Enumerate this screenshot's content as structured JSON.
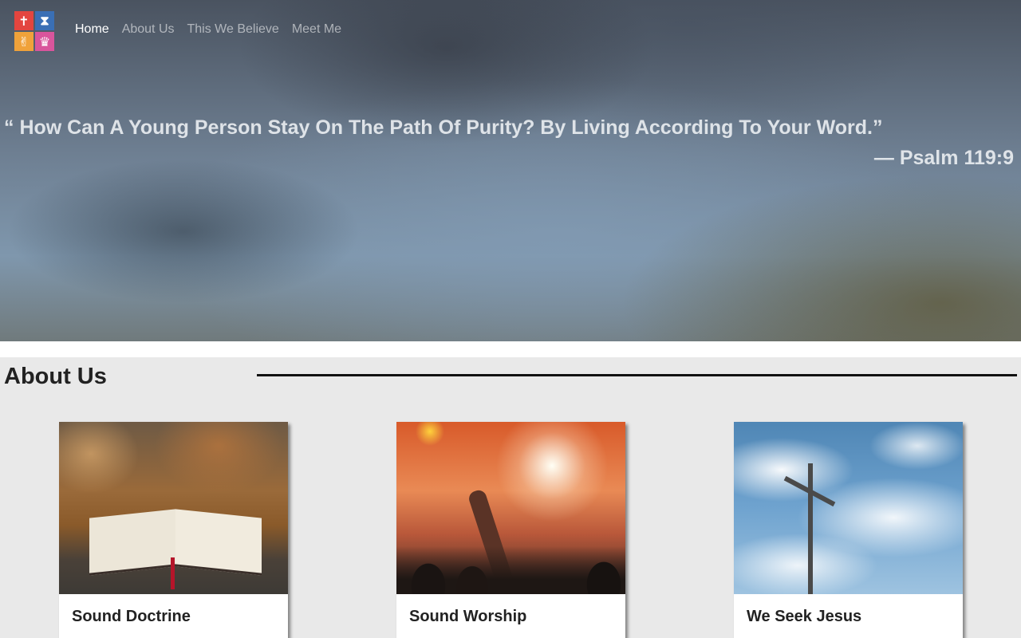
{
  "nav": {
    "logo_alt": "Site logo",
    "links": [
      {
        "label": "Home",
        "active": true
      },
      {
        "label": "About Us",
        "active": false
      },
      {
        "label": "This We Believe",
        "active": false
      },
      {
        "label": "Meet Me",
        "active": false
      }
    ]
  },
  "hero": {
    "quote": "“ How Can A Young Person Stay On The Path Of Purity? By Living According To Your Word.”",
    "citation": "— Psalm 119:9"
  },
  "about": {
    "title": "About Us",
    "cards": [
      {
        "title": "Sound Doctrine",
        "image": "open bible photo"
      },
      {
        "title": "Sound Worship",
        "image": "worship concert photo"
      },
      {
        "title": "We Seek Jesus",
        "image": "cross against sky photo"
      }
    ]
  },
  "colors": {
    "logo_red": "#e3453f",
    "logo_blue": "#3a6fb5",
    "logo_orange": "#f0a23a",
    "logo_pink": "#d9559c",
    "section_bg": "#e9e9e9"
  }
}
